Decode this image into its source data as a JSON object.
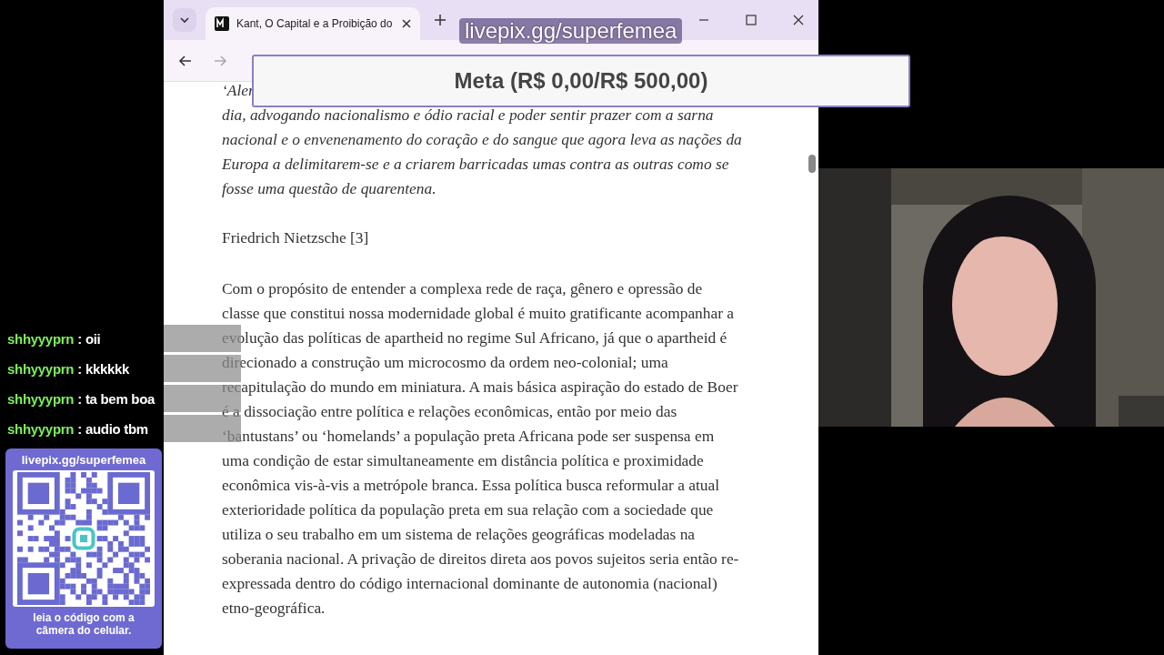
{
  "browser": {
    "tab": {
      "title": "Kant, O Capital e a Proibição do",
      "selected": true
    },
    "article": {
      "quote_fragment": "‘Aler",
      "quote": "dia, advogando nacionalismo e ódio racial e poder sentir prazer com a sarna nacional e o envenenamento do coração e do sangue que agora leva as nações da Europa a delimitarem-se e a criarem barricadas umas contra as outras como se fosse uma questão de quarentena.",
      "attribution": "Friedrich Nietzsche [3]",
      "paragraph": "Com o propósito de entender a complexa rede de raça, gênero e opressão de classe que constitui nossa modernidade global é muito gratificante acompanhar a evolução das políticas de apartheid no regime Sul Africano, já que o apartheid é direcionado a construção um microcosmo da ordem neo-colonial; uma recapitulação do mundo em miniatura. A mais básica aspiração do estado de Boer é a dissociação entre política e relações econômicas, então por meio das ‘bantustans’ ou ‘homelands’ a população preta Africana pode ser suspensa em uma condição de estar simultaneamente em distância política e proximidade econômica vis-à-vis a metrópole branca. Essa política busca reformular a atual exterioridade política da população preta em sua relação com a sociedade que utiliza o seu trabalho em um sistema de relações geográficas modeladas na soberania nacional. A privação de direitos direta aos povos sujeitos seria então re-expressada dentro do código internacional dominante de autonomia (nacional) etno-geográfica."
    }
  },
  "overlay": {
    "donation_link": "livepix.gg/superfemea",
    "goal": "Meta (R$ 0,00/R$ 500,00)"
  },
  "chat": [
    {
      "user": "shhyyyprn",
      "separator": ":",
      "message": "oii"
    },
    {
      "user": "shhyyyprn",
      "separator": ":",
      "message": "kkkkkk"
    },
    {
      "user": "shhyyyprn",
      "separator": ":",
      "message": "ta bem boa"
    },
    {
      "user": "shhyyyprn",
      "separator": ":",
      "message": "audio tbm"
    }
  ],
  "qr_card": {
    "title": "livepix.gg/superfemea",
    "caption": "leia o código com a câmera do celular."
  }
}
